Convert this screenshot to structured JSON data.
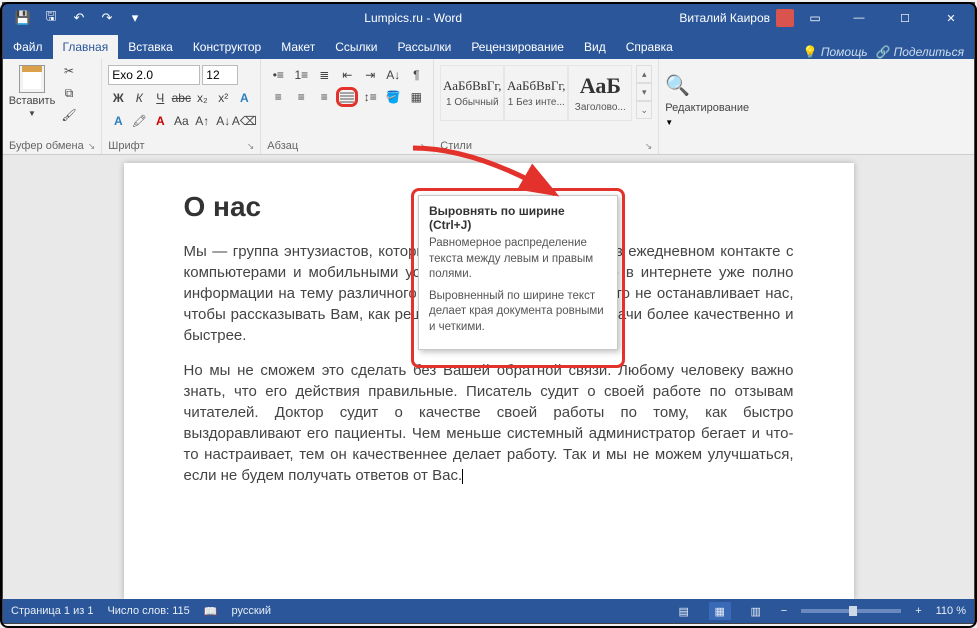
{
  "title": "Lumpics.ru - Word",
  "user": "Виталий Каиров",
  "tabs": [
    "Файл",
    "Главная",
    "Вставка",
    "Конструктор",
    "Макет",
    "Ссылки",
    "Рассылки",
    "Рецензирование",
    "Вид",
    "Справка"
  ],
  "activeTab": 1,
  "help": "Помощь",
  "share": "Поделиться",
  "clipboard": {
    "label": "Буфер обмена",
    "paste": "Вставить"
  },
  "font": {
    "label": "Шрифт",
    "name": "Exo 2.0",
    "size": "12"
  },
  "paragraph": {
    "label": "Абзац"
  },
  "styles": {
    "label": "Стили",
    "items": [
      {
        "preview": "АаБбВвГг,",
        "name": "1 Обычный"
      },
      {
        "preview": "АаБбВвГг,",
        "name": "1 Без инте..."
      },
      {
        "preview": "АаБ",
        "name": "Заголово..."
      }
    ]
  },
  "editing": {
    "label": "Редактирование"
  },
  "doc": {
    "heading": "О нас",
    "p1": "Мы — группа энтузиастов, которым нравится помогать Вам в ежедневном контакте с компьютерами и мобильными устройствами. Мы знаем, что в интернете уже полно информации на тему различного рода проблем с ними. Но это не останавливает нас, чтобы рассказывать Вам, как решать многие проблемы и задачи более качественно и быстрее.",
    "p2": "Но мы не сможем это сделать без Вашей обратной связи. Любому человеку важно знать, что его действия правильные. Писатель судит о своей работе по отзывам читателей. Доктор судит о качестве своей работы по тому, как быстро выздоравливают его пациенты. Чем меньше системный администратор бегает и что-то настраивает, тем он качественнее делает работу. Так и мы не можем улучшаться, если не будем получать ответов от Вас."
  },
  "tooltip": {
    "title": "Выровнять по ширине (Ctrl+J)",
    "p1": "Равномерное распределение текста между левым и правым полями.",
    "p2": "Выровненный по ширине текст делает края документа ровными и четкими."
  },
  "status": {
    "page": "Страница 1 из 1",
    "words": "Число слов: 115",
    "lang": "русский",
    "zoom": "110 %"
  }
}
